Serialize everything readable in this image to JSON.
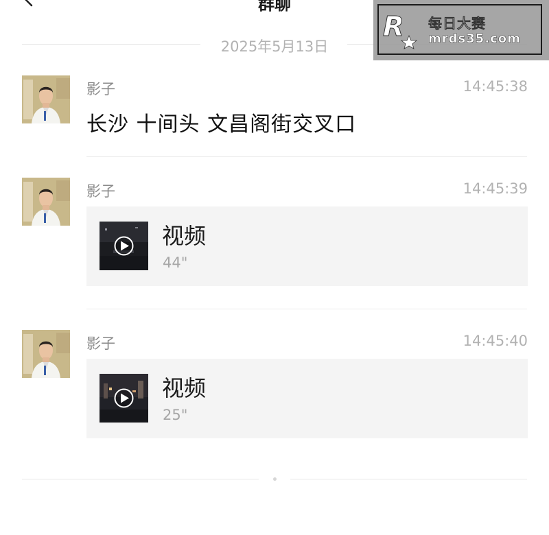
{
  "header": {
    "title": "群聊"
  },
  "watermark": {
    "brand_title": "每日大赛",
    "url": "mrds35.com"
  },
  "date_divider": "2025年5月13日",
  "messages": [
    {
      "sender": "影子",
      "time": "14:45:38",
      "type": "text",
      "text": "长沙 十间头 文昌阁街交叉口"
    },
    {
      "sender": "影子",
      "time": "14:45:39",
      "type": "video",
      "video_label": "视频",
      "duration": "44\""
    },
    {
      "sender": "影子",
      "time": "14:45:40",
      "type": "video",
      "video_label": "视频",
      "duration": "25\""
    }
  ],
  "icons": {
    "back": "chevron-left-icon",
    "play": "play-icon"
  },
  "colors": {
    "background": "#ffffff",
    "secondary_text": "#b2b2b2",
    "card_background": "#f4f4f4"
  }
}
